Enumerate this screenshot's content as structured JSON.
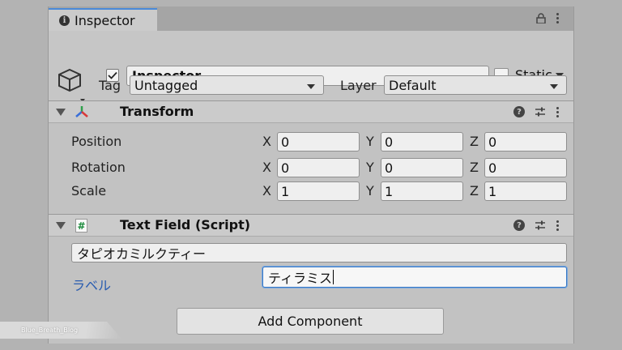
{
  "tab": {
    "title": "Inspector",
    "icon": "info-icon"
  },
  "object": {
    "active": true,
    "name": "Inspector",
    "static_label": "Static",
    "tag_label": "Tag",
    "tag_value": "Untagged",
    "layer_label": "Layer",
    "layer_value": "Default"
  },
  "transform": {
    "title": "Transform",
    "rows": [
      {
        "label": "Position",
        "x": "0",
        "y": "0",
        "z": "0"
      },
      {
        "label": "Rotation",
        "x": "0",
        "y": "0",
        "z": "0"
      },
      {
        "label": "Scale",
        "x": "1",
        "y": "1",
        "z": "1"
      }
    ],
    "axes": {
      "x": "X",
      "y": "Y",
      "z": "Z"
    }
  },
  "text_field": {
    "title": "Text Field (Script)",
    "icon_glyph": "#",
    "text_value": "タピオカミルクティー",
    "label": "ラベル",
    "label_value": "ティラミス"
  },
  "add_component_label": "Add Component",
  "watermark": "Blue_Breath_Blog",
  "colors": {
    "accent": "#4a8ad8",
    "label_blue": "#2a5db0",
    "panel": "#c2c2c2"
  }
}
